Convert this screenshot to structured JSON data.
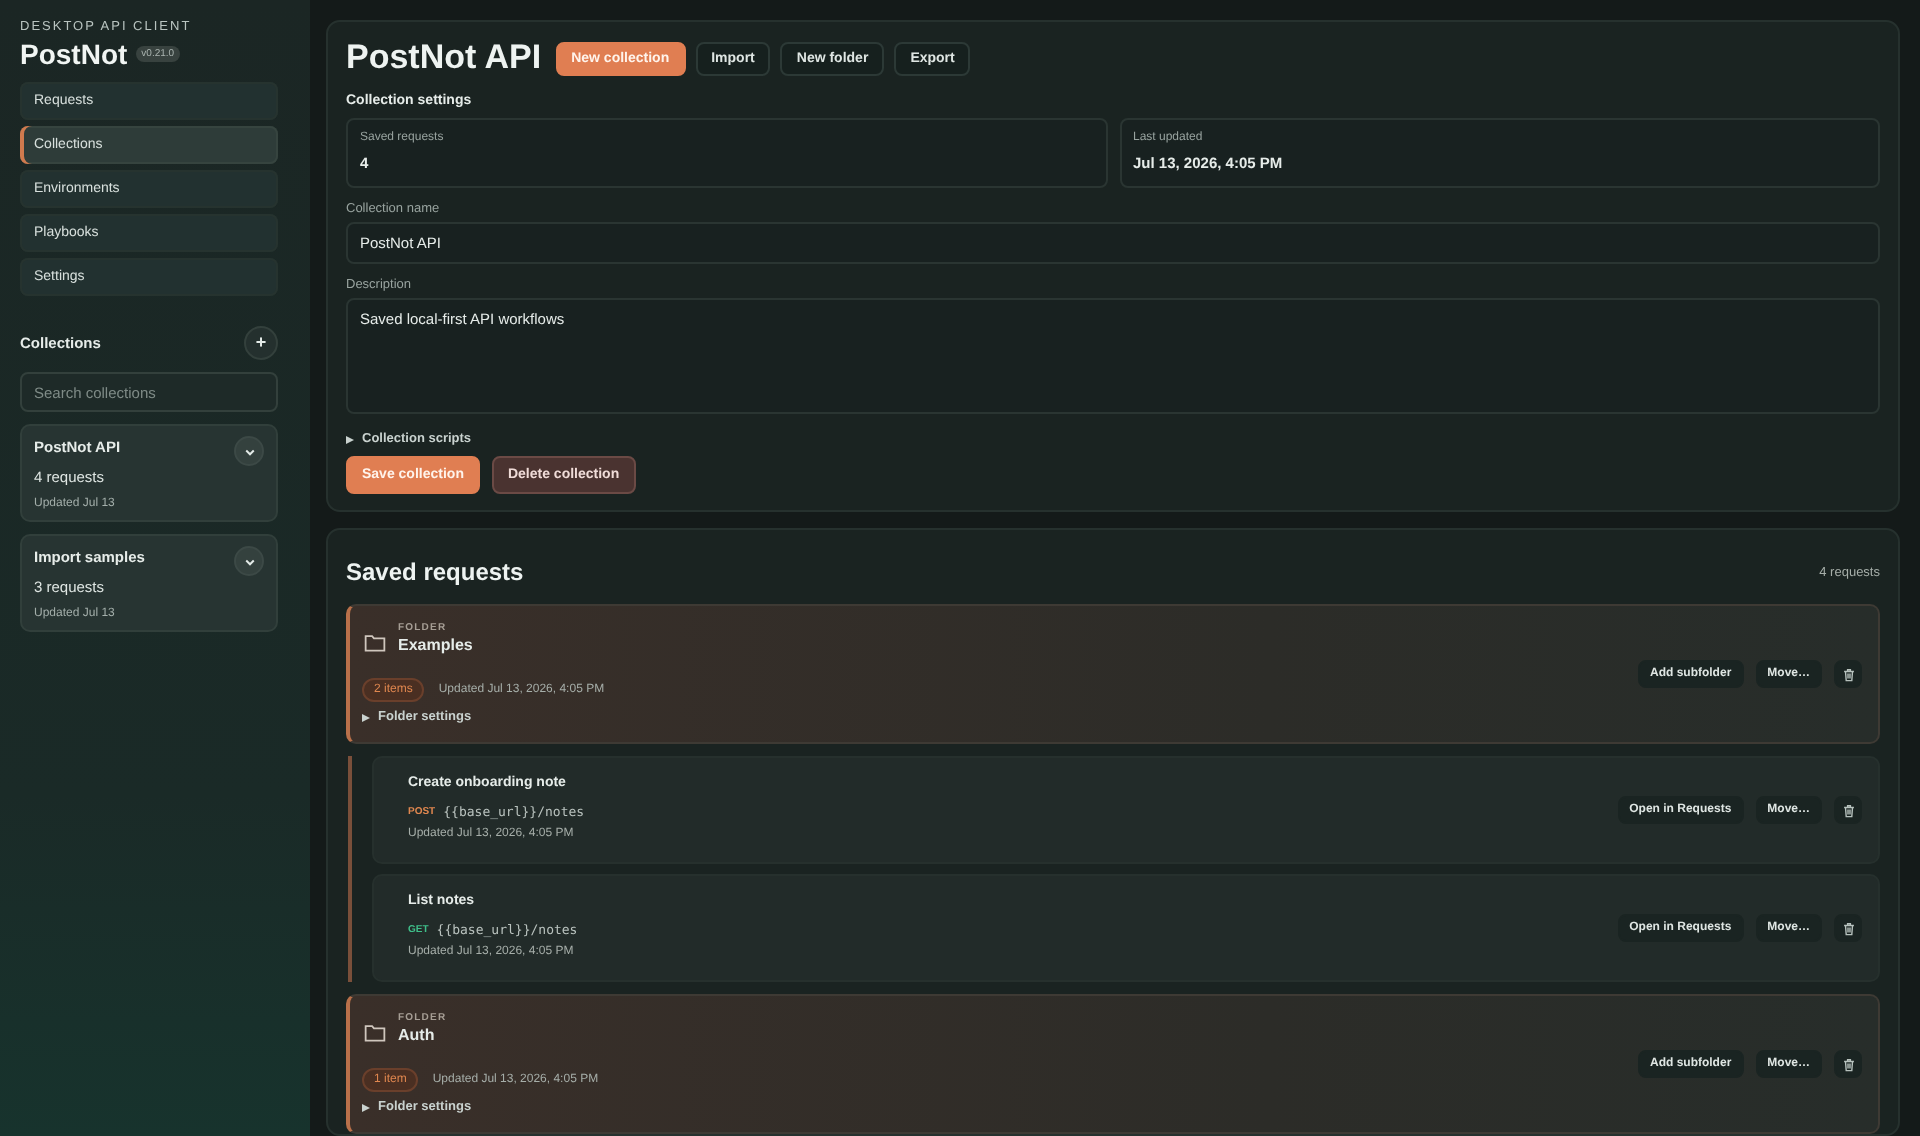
{
  "app": {
    "eyebrow": "DESKTOP API CLIENT",
    "name": "PostNot",
    "version": "v0.21.0"
  },
  "nav": [
    {
      "label": "Requests",
      "selected": false
    },
    {
      "label": "Collections",
      "selected": true
    },
    {
      "label": "Environments",
      "selected": false
    },
    {
      "label": "Playbooks",
      "selected": false
    },
    {
      "label": "Settings",
      "selected": false
    }
  ],
  "collections_sidebar": {
    "heading": "Collections",
    "add_button": "+",
    "search": {
      "placeholder": "Search collections"
    },
    "items": [
      {
        "name": "PostNot API",
        "count": "4 requests",
        "updated": "Updated Jul 13"
      },
      {
        "name": "Import samples",
        "count": "3 requests",
        "updated": "Updated Jul 13"
      }
    ]
  },
  "collection": {
    "title": "PostNot API",
    "actions": [
      {
        "label": "New collection",
        "kind": "primary"
      },
      {
        "label": "Import",
        "kind": "outline"
      },
      {
        "label": "New folder",
        "kind": "outline"
      },
      {
        "label": "Export",
        "kind": "outline"
      }
    ],
    "settings_heading": "Collection settings",
    "stats": [
      {
        "label": "Saved requests",
        "value": "4"
      },
      {
        "label": "Last updated",
        "value": "Jul 13, 2026, 4:05 PM"
      }
    ],
    "name_field": {
      "label": "Collection name",
      "value": "PostNot API"
    },
    "description_field": {
      "label": "Description",
      "value": "Saved local-first API workflows"
    },
    "scripts_toggle": {
      "label": "Collection scripts",
      "expanded": false
    },
    "buttons": [
      {
        "label": "Save collection",
        "kind": "primary"
      },
      {
        "label": "Delete collection",
        "kind": "danger"
      }
    ]
  },
  "saved_requests": {
    "title": "Saved requests",
    "count": "4 requests",
    "entries": [
      {
        "kind": "folder",
        "eyebrow": "FOLDER",
        "name": "Examples",
        "badge": "2 items",
        "updated": "Updated Jul 13, 2026, 4:05 PM",
        "settings_toggle": {
          "label": "Folder settings",
          "expanded": false
        },
        "actions": [
          "Add subfolder",
          "Move…"
        ],
        "children": [
          {
            "kind": "request",
            "name": "Create onboarding note",
            "method": "POST",
            "color": "#e0874f",
            "url": "{{base_url}}/notes",
            "updated": "Updated Jul 13, 2026, 4:05 PM",
            "actions": [
              "Open in Requests",
              "Move…"
            ]
          },
          {
            "kind": "request",
            "name": "List notes",
            "method": "GET",
            "color": "#3fbf8a",
            "url": "{{base_url}}/notes",
            "updated": "Updated Jul 13, 2026, 4:05 PM",
            "actions": [
              "Open in Requests",
              "Move…"
            ]
          }
        ]
      },
      {
        "kind": "folder",
        "eyebrow": "FOLDER",
        "name": "Auth",
        "badge": "1 item",
        "updated": "Updated Jul 13, 2026, 4:05 PM",
        "settings_toggle": {
          "label": "Folder settings",
          "expanded": false
        },
        "actions": [
          "Add subfolder",
          "Move…"
        ]
      }
    ]
  }
}
